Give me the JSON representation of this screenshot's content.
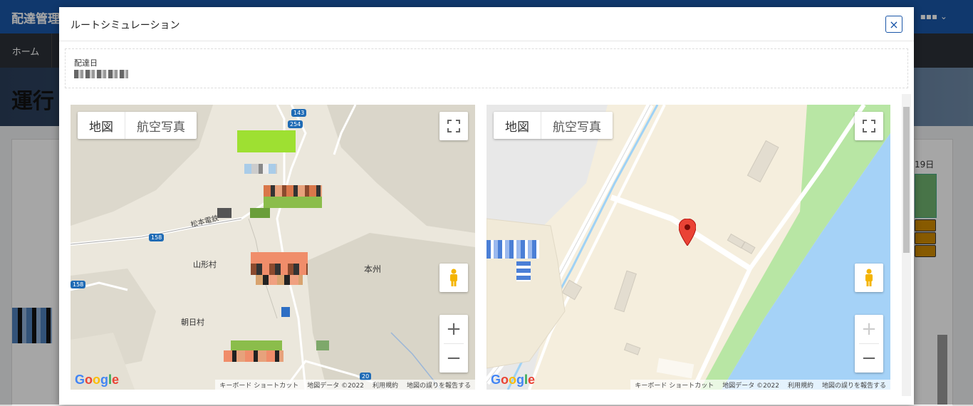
{
  "app": {
    "title": "配達管理",
    "nav_home": "ホーム",
    "banner_text": "運行",
    "bg_date": "19日"
  },
  "modal": {
    "title": "ルートシミュレーション",
    "close_icon": "×",
    "date_label": "配達日"
  },
  "map_left": {
    "maptype_map": "地図",
    "maptype_aerial": "航空写真",
    "places": [
      "山形村",
      "朝日村",
      "本州"
    ],
    "road_labels": [
      "158",
      "254",
      "143",
      "20"
    ],
    "road_name": "松本電鉄",
    "attribution": [
      "キーボード ショートカット",
      "地図データ ©2022",
      "利用規約",
      "地図の誤りを報告する"
    ],
    "google": "Google"
  },
  "map_right": {
    "maptype_map": "地図",
    "maptype_aerial": "航空写真",
    "attribution": [
      "キーボード ショートカット",
      "地図データ ©2022",
      "利用規約",
      "地図の誤りを報告する"
    ],
    "google": "Google"
  },
  "icons": {
    "fullscreen": "fullscreen-icon",
    "pegman": "pegman-icon",
    "zoom_in": "+",
    "zoom_out": "−"
  }
}
